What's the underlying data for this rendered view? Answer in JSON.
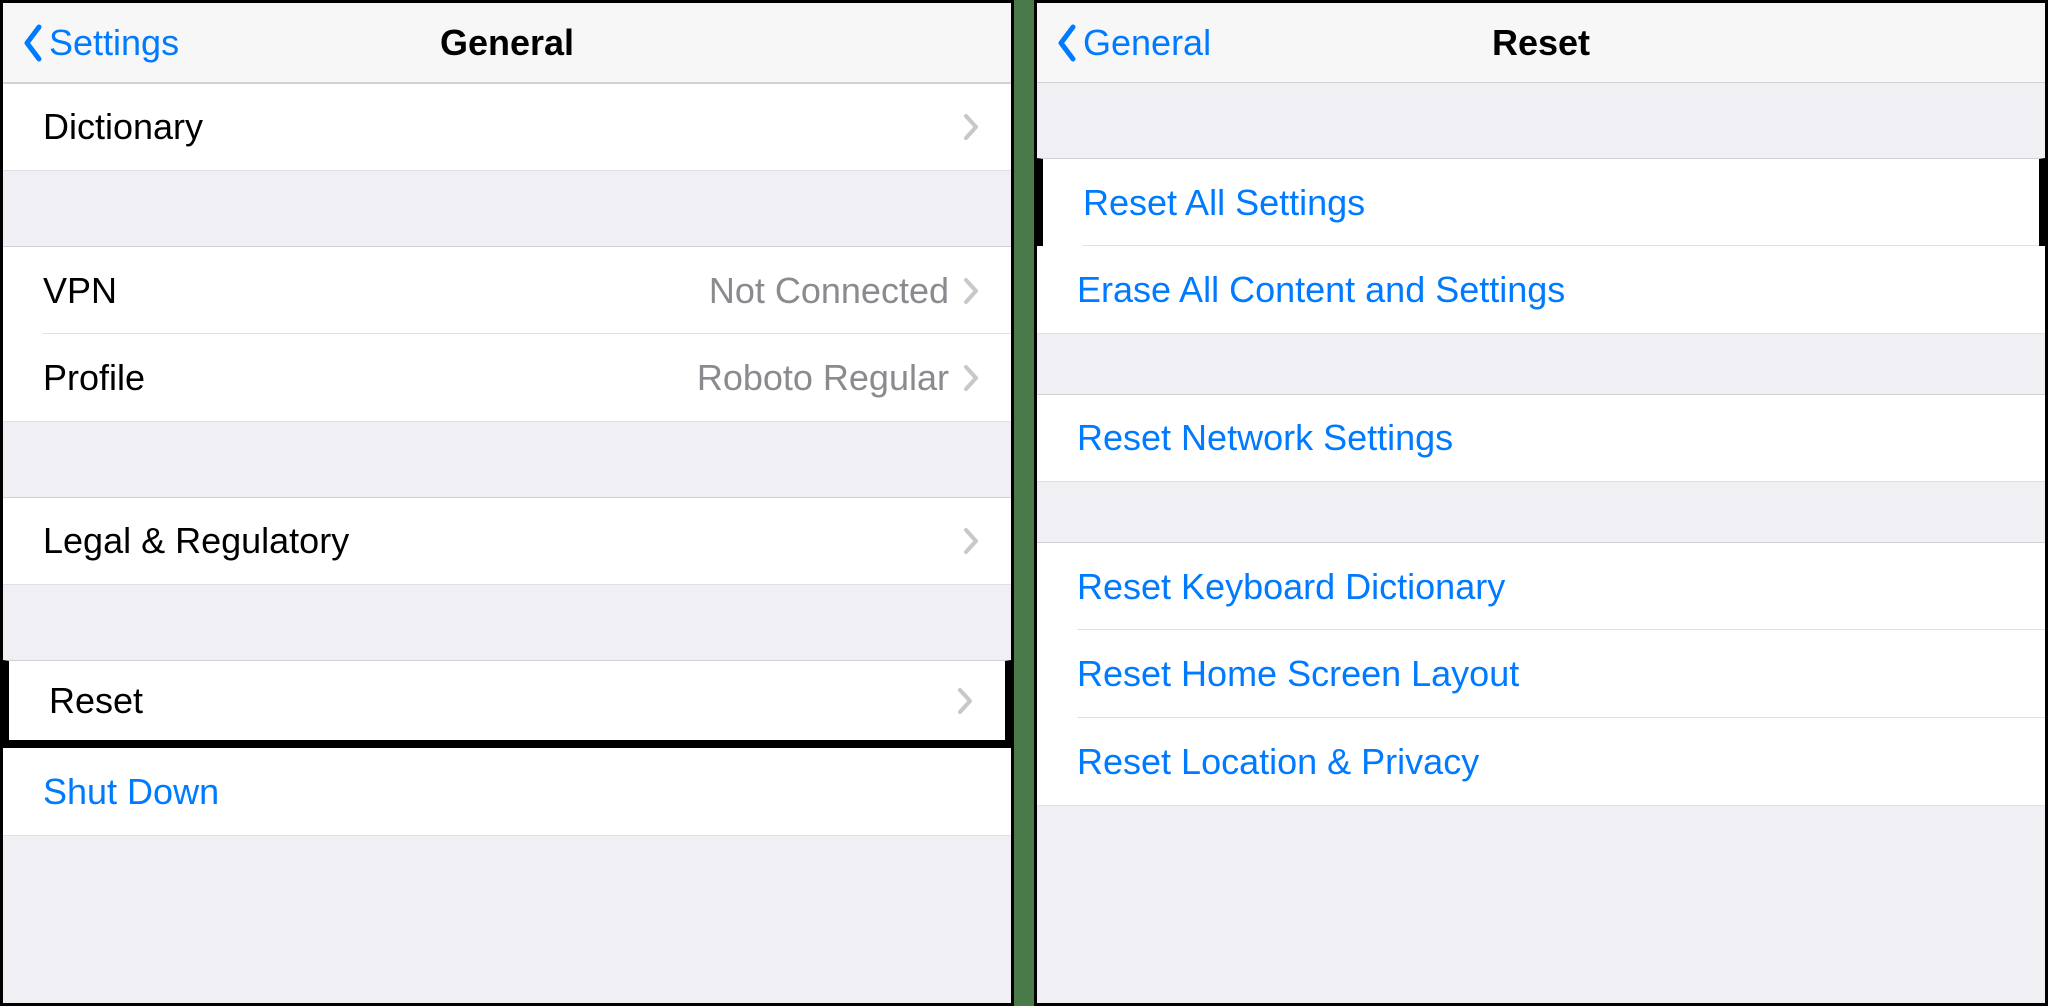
{
  "left": {
    "back_label": "Settings",
    "title": "General",
    "rows": {
      "dictionary": {
        "label": "Dictionary"
      },
      "vpn": {
        "label": "VPN",
        "value": "Not Connected"
      },
      "profile": {
        "label": "Profile",
        "value": "Roboto Regular"
      },
      "legal": {
        "label": "Legal & Regulatory"
      },
      "reset": {
        "label": "Reset"
      },
      "shutdown": {
        "label": "Shut Down"
      }
    }
  },
  "right": {
    "back_label": "General",
    "title": "Reset",
    "rows": {
      "reset_all": {
        "label": "Reset All Settings"
      },
      "erase_all": {
        "label": "Erase All Content and Settings"
      },
      "reset_network": {
        "label": "Reset Network Settings"
      },
      "reset_keyboard": {
        "label": "Reset Keyboard Dictionary"
      },
      "reset_home": {
        "label": "Reset Home Screen Layout"
      },
      "reset_location": {
        "label": "Reset Location & Privacy"
      }
    }
  }
}
